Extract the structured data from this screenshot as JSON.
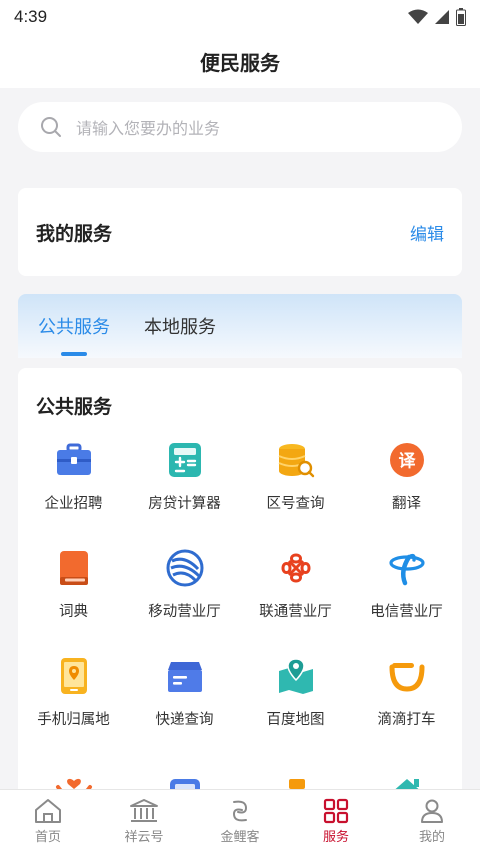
{
  "status": {
    "time": "4:39"
  },
  "header": {
    "title": "便民服务"
  },
  "search": {
    "placeholder": "请输入您要办的业务"
  },
  "my_services": {
    "title": "我的服务",
    "edit": "编辑"
  },
  "tabs": [
    {
      "label": "公共服务"
    },
    {
      "label": "本地服务"
    }
  ],
  "public": {
    "title": "公共服务",
    "items": [
      {
        "label": "企业招聘",
        "icon": "briefcase-icon"
      },
      {
        "label": "房贷计算器",
        "icon": "calculator-icon"
      },
      {
        "label": "区号查询",
        "icon": "coins-search-icon"
      },
      {
        "label": "翻译",
        "icon": "translate-icon"
      },
      {
        "label": "词典",
        "icon": "dictionary-icon"
      },
      {
        "label": "移动营业厅",
        "icon": "china-mobile-icon"
      },
      {
        "label": "联通营业厅",
        "icon": "china-unicom-icon"
      },
      {
        "label": "电信营业厅",
        "icon": "china-telecom-icon"
      },
      {
        "label": "手机归属地",
        "icon": "phone-location-icon"
      },
      {
        "label": "快递查询",
        "icon": "package-icon"
      },
      {
        "label": "百度地图",
        "icon": "map-icon"
      },
      {
        "label": "滴滴打车",
        "icon": "didi-icon"
      }
    ]
  },
  "nav": [
    {
      "label": "首页"
    },
    {
      "label": "祥云号"
    },
    {
      "label": "金鲤客"
    },
    {
      "label": "服务"
    },
    {
      "label": "我的"
    }
  ],
  "colors": {
    "accent": "#2b8be8",
    "nav_active": "#c8102e"
  }
}
